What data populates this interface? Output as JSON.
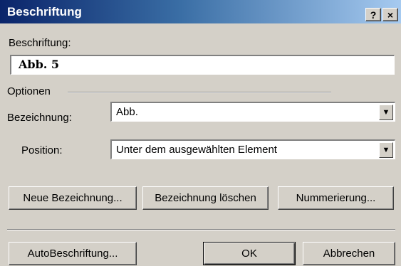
{
  "dialog": {
    "title": "Beschriftung",
    "help_button": "?",
    "close_button": "×"
  },
  "caption": {
    "label": "Beschriftung:",
    "value": "Abb. 5"
  },
  "options": {
    "group_label": "Optionen",
    "label_field": {
      "label": "Bezeichnung:",
      "value": "Abb."
    },
    "position_field": {
      "label": "Position:",
      "value": "Unter dem ausgewählten Element"
    }
  },
  "buttons": {
    "new_label": "Neue Bezeichnung...",
    "delete_label": "Bezeichnung löschen",
    "numbering": "Nummerierung...",
    "autocaption": "AutoBeschriftung...",
    "ok": "OK",
    "cancel": "Abbrechen"
  },
  "icons": {
    "dropdown": "chevron-down-icon"
  }
}
